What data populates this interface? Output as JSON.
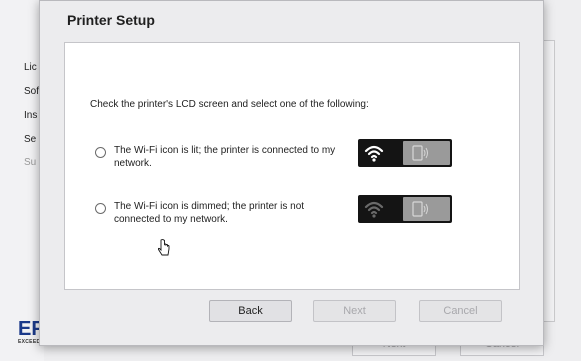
{
  "background_window": {
    "steps": [
      {
        "label": "Lic",
        "state": "done"
      },
      {
        "label": "Sof",
        "state": "done"
      },
      {
        "label": "Ins",
        "state": "done"
      },
      {
        "label": "Se",
        "state": "current"
      },
      {
        "label": "Su",
        "state": "pending"
      }
    ],
    "logo_text": "EP",
    "tagline": "EXCEED YOUR VISION",
    "next_label": "Next",
    "cancel_label": "Cancel"
  },
  "dialog": {
    "title": "Printer Setup",
    "instruction": "Check the printer's LCD screen and select one of the following:",
    "options": [
      {
        "label": "The Wi-Fi icon is lit; the printer is connected to my network.",
        "wifi_icon": "wifi-lit-icon",
        "wifi_color": "#ffffff",
        "selected": false
      },
      {
        "label": "The Wi-Fi icon is dimmed; the printer is not connected to my network.",
        "wifi_icon": "wifi-dimmed-icon",
        "wifi_color": "#6a6a6a",
        "selected": false
      }
    ],
    "buttons": {
      "back_label": "Back",
      "next_label": "Next",
      "cancel_label": "Cancel"
    }
  },
  "colors": {
    "logo_blue": "#1b3a8a",
    "lcd_background": "#141414",
    "lcd_panel": "#9a9a9a"
  }
}
